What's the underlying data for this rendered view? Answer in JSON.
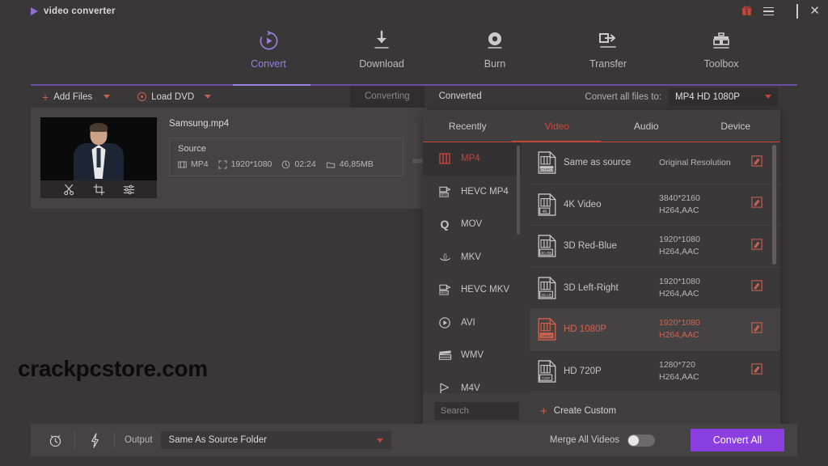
{
  "titlebar": {
    "brand": "video converter",
    "window_controls": [
      {
        "name": "gift-icon",
        "label": "☗"
      },
      {
        "name": "menu-icon",
        "label": "≡"
      },
      {
        "name": "minimize-button",
        "label": "—"
      },
      {
        "name": "maximize-button",
        "label": "□"
      },
      {
        "name": "close-button",
        "label": "✕"
      }
    ]
  },
  "mainnav": {
    "items": [
      {
        "label": "Convert",
        "icon": "convert-icon",
        "active": true
      },
      {
        "label": "Download",
        "icon": "download-icon",
        "active": false
      },
      {
        "label": "Burn",
        "icon": "burn-icon",
        "active": false
      },
      {
        "label": "Transfer",
        "icon": "transfer-icon",
        "active": false
      },
      {
        "label": "Toolbox",
        "icon": "toolbox-icon",
        "active": false
      }
    ],
    "accent_color": "#9c7de0"
  },
  "toolbar": {
    "add_files": "Add Files",
    "load_dvd": "Load DVD",
    "tab_converting": "Converting",
    "tab_converted": "Converted",
    "convert_all_label": "Convert all files to:",
    "convert_all_value": "MP4 HD 1080P"
  },
  "file_card": {
    "filename": "Samsung.mp4",
    "source_title": "Source",
    "format": "MP4",
    "resolution": "1920*1080",
    "duration": "02:24",
    "size": "46,85MB",
    "thumb_actions": [
      "trim-icon",
      "crop-icon",
      "effects-icon"
    ]
  },
  "watermark": "crackpcstore.com",
  "format_panel": {
    "tabs": [
      {
        "label": "Recently",
        "active": false
      },
      {
        "label": "Video",
        "active": true
      },
      {
        "label": "Audio",
        "active": false
      },
      {
        "label": "Device",
        "active": false
      }
    ],
    "accent_color": "#c2473a",
    "formats": [
      {
        "label": "MP4",
        "icon": "film-strip-icon",
        "active": true
      },
      {
        "label": "HEVC MP4",
        "icon": "hevc-icon",
        "active": false
      },
      {
        "label": "MOV",
        "icon": "quicktime-icon",
        "active": false
      },
      {
        "label": "MKV",
        "icon": "mkv-icon",
        "active": false
      },
      {
        "label": "HEVC MKV",
        "icon": "hevc-icon",
        "active": false
      },
      {
        "label": "AVI",
        "icon": "play-circle-icon",
        "active": false
      },
      {
        "label": "WMV",
        "icon": "clapperboard-icon",
        "active": false
      },
      {
        "label": "M4V",
        "icon": "flag-icon",
        "active": false
      }
    ],
    "presets": [
      {
        "name": "Same as source",
        "badge": "SOURCE",
        "resolution": "Original Resolution",
        "codec": "",
        "active": false
      },
      {
        "name": "4K Video",
        "badge": "4K",
        "resolution": "3840*2160",
        "codec": "H264,AAC",
        "active": false
      },
      {
        "name": "3D Red-Blue",
        "badge": "3D RB",
        "resolution": "1920*1080",
        "codec": "H264,AAC",
        "active": false
      },
      {
        "name": "3D Left-Right",
        "badge": "3D LR",
        "resolution": "1920*1080",
        "codec": "H264,AAC",
        "active": false
      },
      {
        "name": "HD 1080P",
        "badge": "1080P",
        "resolution": "1920*1080",
        "codec": "H264,AAC",
        "active": true
      },
      {
        "name": "HD 720P",
        "badge": "720P",
        "resolution": "1280*720",
        "codec": "H264,AAC",
        "active": false
      }
    ],
    "search_placeholder": "Search",
    "create_custom": "Create Custom"
  },
  "bottombar": {
    "timer_icon": "alarm-clock-icon",
    "speed_icon": "lightning-bolt-icon",
    "output_label": "Output",
    "output_value": "Same As Source Folder",
    "merge_label": "Merge All Videos",
    "merge_enabled": false,
    "convert_all_button": "Convert All",
    "convert_button_color": "#8b3fe0"
  }
}
